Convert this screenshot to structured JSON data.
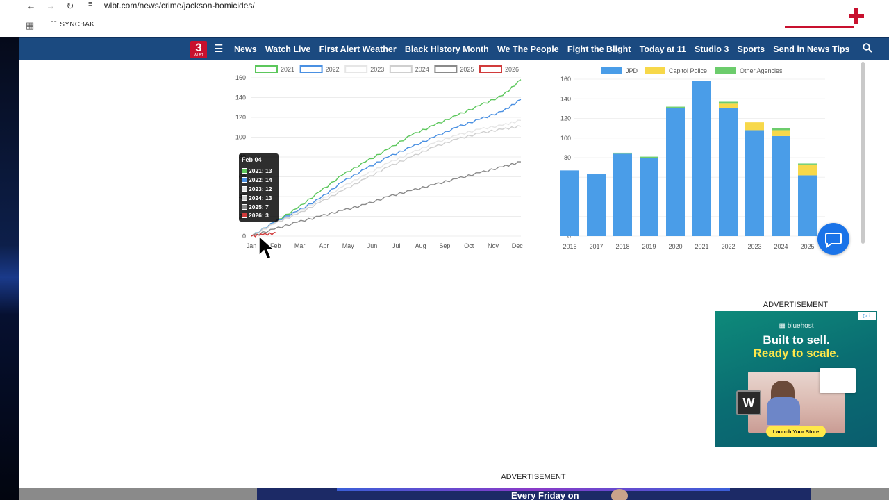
{
  "browser": {
    "url": "wlbt.com/news/crime/jackson-homicides/",
    "bookmark": "SYNCBAK",
    "icons": [
      "back-icon",
      "forward-icon",
      "reload-icon",
      "site-settings-icon",
      "apps-icon"
    ]
  },
  "site": {
    "logo_number": "3",
    "logo_sub": "WLBT",
    "nav_items": [
      "News",
      "Watch Live",
      "First Alert Weather",
      "Black History Month",
      "We The People",
      "Fight the Blight",
      "Today at 11",
      "Studio 3",
      "Sports",
      "Send in News Tips"
    ],
    "accent": "#1b4a80",
    "brand_red": "#c8102e"
  },
  "chart_data": [
    {
      "type": "line",
      "ylim": [
        0,
        160
      ],
      "yticks": [
        0,
        20,
        40,
        60,
        80,
        100,
        120,
        140,
        160
      ],
      "xticks": [
        "Jan",
        "Feb",
        "Mar",
        "Apr",
        "May",
        "Jun",
        "Jul",
        "Aug",
        "Sep",
        "Oct",
        "Nov",
        "Dec"
      ],
      "series": [
        {
          "name": "2021",
          "color": "#5cc75c",
          "x": [
            0,
            1,
            2,
            3,
            4,
            5,
            6,
            7,
            8,
            9,
            10,
            11,
            11.8
          ],
          "y": [
            0,
            14,
            28,
            45,
            62,
            75,
            88,
            102,
            112,
            122,
            132,
            142,
            158
          ]
        },
        {
          "name": "2022",
          "color": "#4a90e2",
          "x": [
            0,
            1,
            2,
            3,
            4,
            5,
            6,
            7,
            8,
            9,
            10,
            11,
            11.8
          ],
          "y": [
            0,
            14,
            25,
            38,
            55,
            68,
            80,
            90,
            100,
            110,
            118,
            126,
            138
          ]
        },
        {
          "name": "2023",
          "color": "#e6e6e6",
          "x": [
            0,
            1,
            2,
            3,
            4,
            5,
            6,
            7,
            8,
            9,
            10,
            11,
            11.8
          ],
          "y": [
            0,
            12,
            24,
            36,
            50,
            62,
            74,
            84,
            94,
            102,
            108,
            112,
            117
          ]
        },
        {
          "name": "2024",
          "color": "#cfcfcf",
          "x": [
            0,
            1,
            2,
            3,
            4,
            5,
            6,
            7,
            8,
            9,
            10,
            11,
            11.8
          ],
          "y": [
            0,
            13,
            22,
            34,
            46,
            58,
            70,
            80,
            90,
            98,
            104,
            108,
            111
          ]
        },
        {
          "name": "2025",
          "color": "#8a8a8a",
          "x": [
            0,
            1,
            2,
            3,
            4,
            5,
            6,
            7,
            8,
            9,
            10,
            11,
            11.8
          ],
          "y": [
            0,
            7,
            14,
            20,
            26,
            32,
            40,
            46,
            52,
            58,
            64,
            70,
            75
          ]
        },
        {
          "name": "2026",
          "color": "#d13b3b",
          "x": [
            0,
            0.5,
            1.1
          ],
          "y": [
            0,
            1.5,
            3
          ]
        }
      ],
      "tooltip": {
        "title": "Feb 04",
        "rows": [
          "2021: 13",
          "2022: 14",
          "2023: 12",
          "2024: 13",
          "2025: 7",
          "2026: 3"
        ]
      }
    },
    {
      "type": "bar",
      "stacked": true,
      "ylim": [
        0,
        160
      ],
      "yticks": [
        0,
        20,
        40,
        60,
        80,
        100,
        120,
        140,
        160
      ],
      "categories": [
        "2016",
        "2017",
        "2018",
        "2019",
        "2020",
        "2021",
        "2022",
        "2023",
        "2024",
        "2025"
      ],
      "series": [
        {
          "name": "JPD",
          "color": "#4a9de8",
          "values": [
            67,
            63,
            84,
            80,
            131,
            158,
            131,
            108,
            102,
            62
          ]
        },
        {
          "name": "Capitol Police",
          "color": "#f7d84a",
          "values": [
            0,
            0,
            0,
            0,
            0,
            0,
            4,
            8,
            6,
            11
          ]
        },
        {
          "name": "Other Agencies",
          "color": "#6ccc6c",
          "values": [
            0,
            0,
            1,
            1,
            1,
            0,
            2,
            0,
            2,
            1
          ]
        }
      ]
    }
  ],
  "ads": {
    "label": "ADVERTISEMENT",
    "ad1": {
      "brand": "bluehost",
      "line1": "Built to sell.",
      "line2": "Ready to scale.",
      "cta": "Launch Your Store",
      "logo_letter": "W"
    },
    "ad2": {
      "text": "Every Friday on"
    }
  }
}
